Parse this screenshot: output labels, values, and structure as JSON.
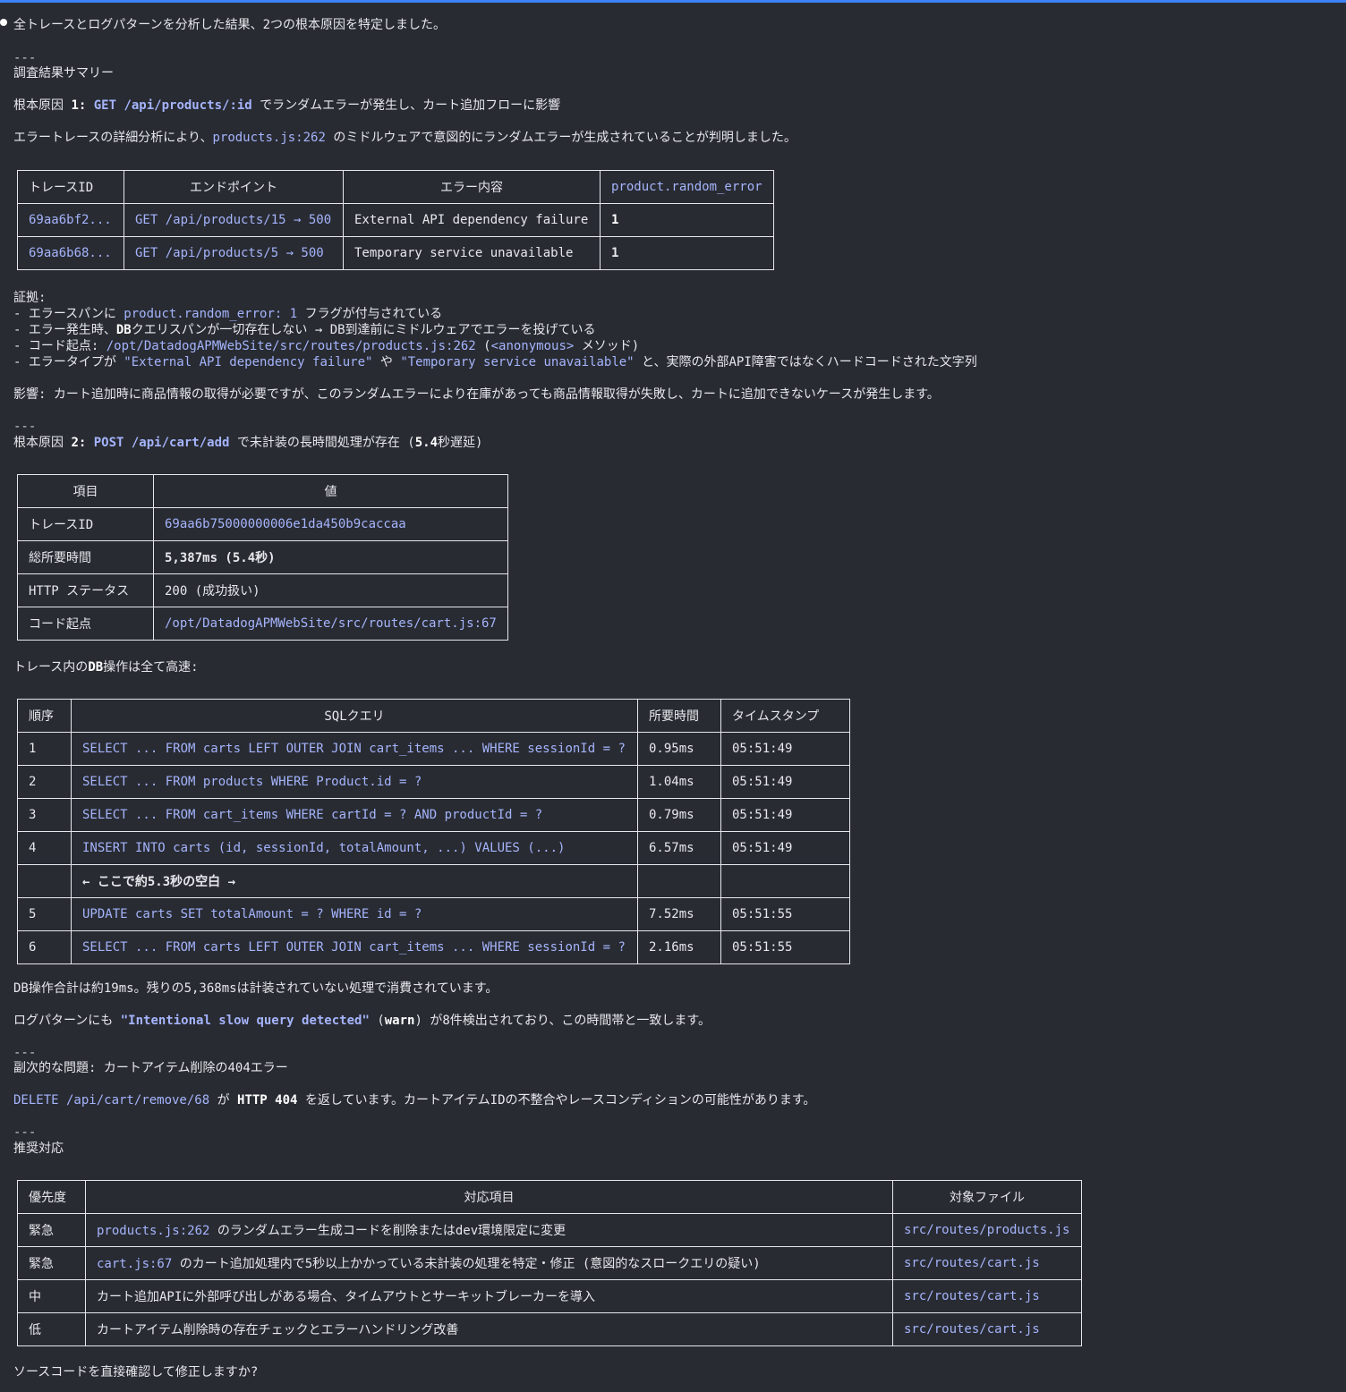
{
  "intro": "全トレースとログパターンを分析した結果、2つの根本原因を特定しました。",
  "sep": "---",
  "summary_title": "調査結果サマリー",
  "rc1": {
    "prefix": "根本原因 ",
    "num": "1:",
    "endpoint": "GET /api/products/:id",
    "suffix": " でランダムエラーが発生し、カート追加フローに影響",
    "desc_pre": "エラートレースの詳細分析により、",
    "desc_code": "products.js:262",
    "desc_post": " のミドルウェアで意図的にランダムエラーが生成されていることが判明しました。",
    "table": {
      "headers": [
        "トレースID",
        "エンドポイント",
        "エラー内容",
        "product.random_error"
      ],
      "rows": [
        [
          "69aa6bf2...",
          "GET /api/products/15 → 500",
          "External API dependency failure",
          "1"
        ],
        [
          "69aa6b68...",
          "GET /api/products/5 → 500",
          "Temporary service unavailable",
          "1"
        ]
      ]
    },
    "evidence_title": "証拠:",
    "evidence": {
      "e1_pre": "- エラースパンに ",
      "e1_code": "product.random_error: 1",
      "e1_post": " フラグが付与されている",
      "e2_pre": "- エラー発生時、",
      "e2_bold": "DB",
      "e2_post": "クエリスパンが一切存在しない → DB到達前にミドルウェアでエラーを投げている",
      "e3_pre": "- コード起点: ",
      "e3_code": "/opt/DatadogAPMWebSite/src/routes/products.js:262",
      "e3_mid": " (",
      "e3_code2": "<anonymous>",
      "e3_post": " メソッド)",
      "e4_pre": "- エラータイプが ",
      "e4_code1": "\"External API dependency failure\"",
      "e4_mid": " や ",
      "e4_code2": "\"Temporary service unavailable\"",
      "e4_post": " と、実際の外部API障害ではなくハードコードされた文字列"
    },
    "impact": "影響: カート追加時に商品情報の取得が必要ですが、このランダムエラーにより在庫があっても商品情報取得が失敗し、カートに追加できないケースが発生します。"
  },
  "rc2": {
    "prefix": "根本原因 ",
    "num": "2:",
    "endpoint": "POST /api/cart/add",
    "suffix_pre": " で未計装の長時間処理が存在 (",
    "suffix_bold": "5.4",
    "suffix_post": "秒遅延)",
    "table": {
      "headers": [
        "項目",
        "値"
      ],
      "rows": [
        [
          "トレースID",
          "69aa6b75000000006e1da450b9caccaa"
        ],
        [
          "総所要時間",
          "5,387ms (5.4秒)"
        ],
        [
          "HTTP ステータス",
          "200 (成功扱い)"
        ],
        [
          "コード起点",
          "/opt/DatadogAPMWebSite/src/routes/cart.js:67"
        ]
      ]
    },
    "db_title_pre": "トレース内の",
    "db_title_bold": "DB",
    "db_title_post": "操作は全て高速:",
    "sql_table": {
      "headers": [
        "順序",
        "SQLクエリ",
        "所要時間",
        "タイムスタンプ"
      ],
      "rows": [
        [
          "1",
          "SELECT ... FROM carts LEFT OUTER JOIN cart_items ... WHERE sessionId = ?",
          "0.95ms",
          "05:51:49"
        ],
        [
          "2",
          "SELECT ... FROM products WHERE Product.id = ?",
          "1.04ms",
          "05:51:49"
        ],
        [
          "3",
          "SELECT ... FROM cart_items WHERE cartId = ? AND productId = ?",
          "0.79ms",
          "05:51:49"
        ],
        [
          "4",
          "INSERT INTO carts (id, sessionId, totalAmount, ...) VALUES (...)",
          "6.57ms",
          "05:51:49"
        ],
        [
          "",
          "← ここで約5.3秒の空白 →",
          "",
          ""
        ],
        [
          "5",
          "UPDATE carts SET totalAmount = ? WHERE id = ?",
          "7.52ms",
          "05:51:55"
        ],
        [
          "6",
          "SELECT ... FROM carts LEFT OUTER JOIN cart_items ... WHERE sessionId = ?",
          "2.16ms",
          "05:51:55"
        ]
      ]
    },
    "db_total": "DB操作合計は約19ms。残りの5,368msは計装されていない処理で消費されています。",
    "log_pre": "ログパターンにも ",
    "log_code": "\"Intentional slow query detected\"",
    "log_mid": " (",
    "log_bold": "warn",
    "log_post": ") が8件検出されており、この時間帯と一致します。"
  },
  "secondary": {
    "title": "副次的な問題: カートアイテム削除の404エラー",
    "code": "DELETE /api/cart/remove/68",
    "mid": " が ",
    "bold": "HTTP 404",
    "post": " を返しています。カートアイテムIDの不整合やレースコンディションの可能性があります。"
  },
  "recommend": {
    "title": "推奨対応",
    "headers": [
      "優先度",
      "対応項目",
      "対象ファイル"
    ],
    "rows": [
      {
        "priority": "緊急",
        "code": "products.js:262",
        "text": " のランダムエラー生成コードを削除またはdev環境限定に変更",
        "file": "src/routes/products.js"
      },
      {
        "priority": "緊急",
        "code": "cart.js:67",
        "text": " のカート追加処理内で5秒以上かかっている未計装の処理を特定・修正 (意図的なスロークエリの疑い)",
        "file": "src/routes/cart.js"
      },
      {
        "priority": "中",
        "code": "",
        "text": "カート追加APIに外部呼び出しがある場合、タイムアウトとサーキットブレーカーを導入",
        "file": "src/routes/cart.js"
      },
      {
        "priority": "低",
        "code": "",
        "text": "カートアイテム削除時の存在チェックとエラーハンドリング改善",
        "file": "src/routes/cart.js"
      }
    ]
  },
  "closing": "ソースコードを直接確認して修正しますか?"
}
